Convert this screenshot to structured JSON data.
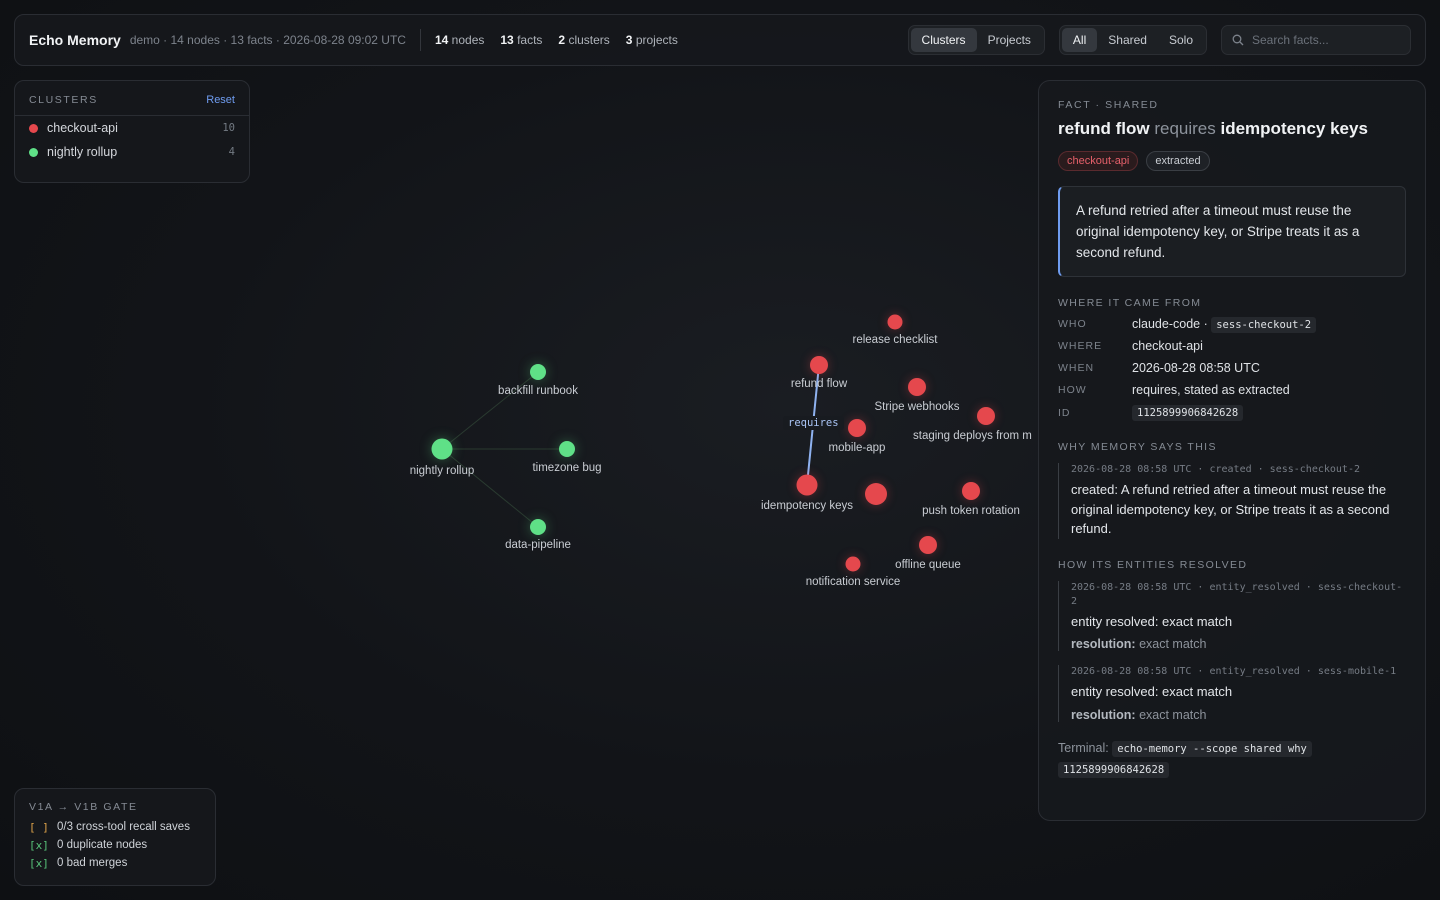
{
  "header": {
    "title": "Echo Memory",
    "meta": "demo · 14 nodes · 13 facts · 2026-08-28 09:02 UTC",
    "stats": [
      {
        "value": "14",
        "label": "nodes"
      },
      {
        "value": "13",
        "label": "facts"
      },
      {
        "value": "2",
        "label": "clusters"
      },
      {
        "value": "3",
        "label": "projects"
      }
    ],
    "view_toggle": [
      "Clusters",
      "Projects"
    ],
    "view_active": "Clusters",
    "scope_toggle": [
      "All",
      "Shared",
      "Solo"
    ],
    "scope_active": "All",
    "search_placeholder": "Search facts..."
  },
  "clusters_panel": {
    "title": "CLUSTERS",
    "reset": "Reset",
    "items": [
      {
        "name": "checkout-api",
        "count": "10",
        "color": "#e5484d"
      },
      {
        "name": "nightly rollup",
        "count": "4",
        "color": "#5fe087"
      }
    ]
  },
  "graph": {
    "edge_label": "requires",
    "nodes": [
      {
        "label": "release checklist",
        "color": "red"
      },
      {
        "label": "refund flow",
        "color": "red"
      },
      {
        "label": "Stripe webhooks",
        "color": "red"
      },
      {
        "label": "staging deploys from m",
        "color": "red"
      },
      {
        "label": "mobile-app",
        "color": "red"
      },
      {
        "label": "idempotency keys",
        "color": "red"
      },
      {
        "label": "",
        "color": "red"
      },
      {
        "label": "push token rotation",
        "color": "red"
      },
      {
        "label": "offline queue",
        "color": "red"
      },
      {
        "label": "notification service",
        "color": "red"
      },
      {
        "label": "backfill runbook",
        "color": "green"
      },
      {
        "label": "nightly rollup",
        "color": "green"
      },
      {
        "label": "timezone bug",
        "color": "green"
      },
      {
        "label": "data-pipeline",
        "color": "green"
      }
    ]
  },
  "gate": {
    "title": "V1A → V1B GATE",
    "items": [
      {
        "mark": "[ ]",
        "text": "0/3 cross-tool recall saves",
        "done": false
      },
      {
        "mark": "[x]",
        "text": "0 duplicate nodes",
        "done": true
      },
      {
        "mark": "[x]",
        "text": "0 bad merges",
        "done": true
      }
    ]
  },
  "detail": {
    "kind": "FACT · SHARED",
    "subject": "refund flow",
    "relation": "requires",
    "object": "idempotency keys",
    "tags": [
      "checkout-api",
      "extracted"
    ],
    "quote": "A refund retried after a timeout must reuse the original idempotency key, or Stripe treats it as a second refund.",
    "provenance_title": "WHERE IT CAME FROM",
    "who_label": "WHO",
    "who": "claude-code ·",
    "who_session": "sess-checkout-2",
    "where_label": "WHERE",
    "where": "checkout-api",
    "when_label": "WHEN",
    "when": "2026-08-28 08:58 UTC",
    "how_label": "HOW",
    "how": "requires, stated as extracted",
    "id_label": "ID",
    "id": "1125899906842628",
    "why_title": "WHY MEMORY SAYS THIS",
    "why_event": {
      "meta": "2026-08-28 08:58 UTC · created · sess-checkout-2",
      "body": "created: A refund retried after a timeout must reuse the original idempotency key, or Stripe treats it as a second refund."
    },
    "resolve_title": "HOW ITS ENTITIES RESOLVED",
    "resolve_events": [
      {
        "meta": "2026-08-28 08:58 UTC · entity_resolved · sess-checkout-2",
        "body": "entity resolved: exact match",
        "res_label": "resolution:",
        "res_value": "exact match"
      },
      {
        "meta": "2026-08-28 08:58 UTC · entity_resolved · sess-mobile-1",
        "body": "entity resolved: exact match",
        "res_label": "resolution:",
        "res_value": "exact match"
      }
    ],
    "terminal_label": "Terminal:",
    "terminal_cmd": "echo-memory --scope shared why",
    "terminal_id": "1125899906842628"
  }
}
